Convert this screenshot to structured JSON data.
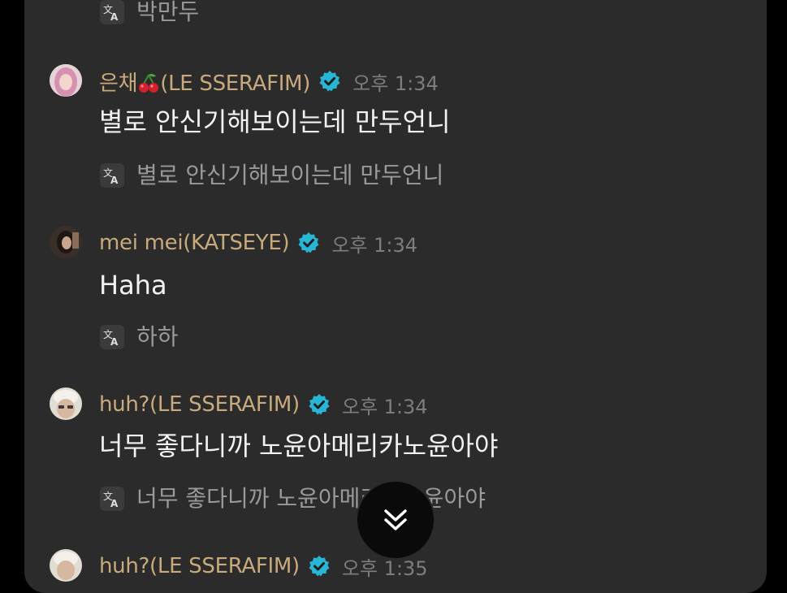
{
  "messages": [
    {
      "author": "",
      "time": "",
      "text": "",
      "translation": "박만두",
      "partial": true
    },
    {
      "author_prefix": "은채",
      "author_emoji": "cherry",
      "author_suffix": "(LE SSERAFIM)",
      "time": "오후 1:34",
      "text": "별로 안신기해보이는데 만두언니",
      "translation": "별로 안신기해보이는데 만두언니",
      "avatar_color": "#d9a0b8"
    },
    {
      "author": "mei mei(KATSEYE)",
      "time": "오후 1:34",
      "text": "Haha",
      "translation": "하하",
      "avatar_color": "#4a3a30"
    },
    {
      "author": "huh?(LE SSERAFIM)",
      "time": "오후 1:34",
      "text": "너무 좋다니까 노윤아메리카노윤아야",
      "translation": "너무 좋다니까 노윤아메리카노윤아야",
      "avatar_color": "#c8c0b0"
    },
    {
      "author": "huh?(LE SSERAFIM)",
      "time": "오후 1:35",
      "avatar_color": "#c8c0b0",
      "partial": true
    }
  ],
  "icons": {
    "translate": "translate-icon",
    "verified": "verified-badge-icon",
    "scroll_down": "double-chevron-down-icon"
  },
  "colors": {
    "author_name": "#c9aa7c",
    "verified_badge": "#29b6d4",
    "panel_bg": "#2b2b2b"
  }
}
